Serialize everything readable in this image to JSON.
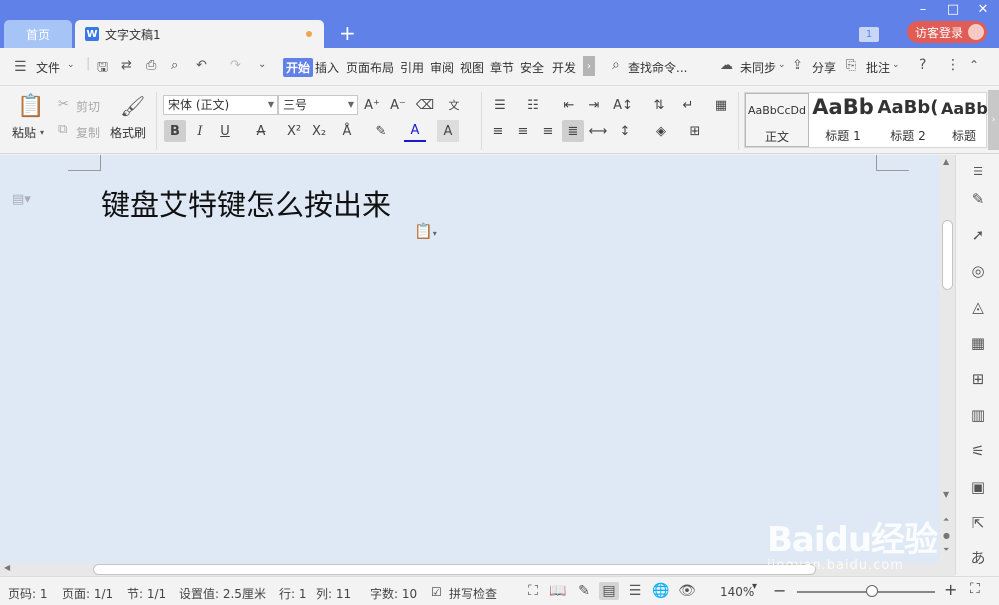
{
  "titlebar": {
    "home_tab": "首页",
    "doc_tab": "文字文稿1",
    "new_tab": "+",
    "badge": "1",
    "login": "访客登录",
    "win_min": "–",
    "win_max": "□",
    "win_close": "✕"
  },
  "menubar": {
    "file": "文件",
    "tabs": [
      "开始",
      "插入",
      "页面布局",
      "引用",
      "审阅",
      "视图",
      "章节",
      "安全",
      "开发"
    ],
    "search": "查找命令...",
    "sync": "未同步",
    "share": "分享",
    "comment": "批注"
  },
  "ribbon": {
    "paste": "粘贴",
    "cut": "剪切",
    "copy": "复制",
    "format_painter": "格式刷",
    "font_name": "宋体 (正文)",
    "font_size": "三号",
    "styles": [
      {
        "sample": "AaBbCcDd",
        "name": "正文"
      },
      {
        "sample": "AaBb",
        "name": "标题 1"
      },
      {
        "sample": "AaBb(",
        "name": "标题 2"
      },
      {
        "sample": "AaBb",
        "name": "标题"
      }
    ]
  },
  "document": {
    "title": "键盘艾特键怎么按出来"
  },
  "status": {
    "page_no": "页码: 1",
    "page": "页面: 1/1",
    "section": "节: 1/1",
    "setting": "设置值: 2.5厘米",
    "row": "行: 1",
    "col": "列: 11",
    "words": "字数: 10",
    "spell": "拼写检查",
    "zoom": "140%"
  },
  "watermark": {
    "brand": "Baidu经验",
    "url": "jingyan.baidu.com"
  }
}
